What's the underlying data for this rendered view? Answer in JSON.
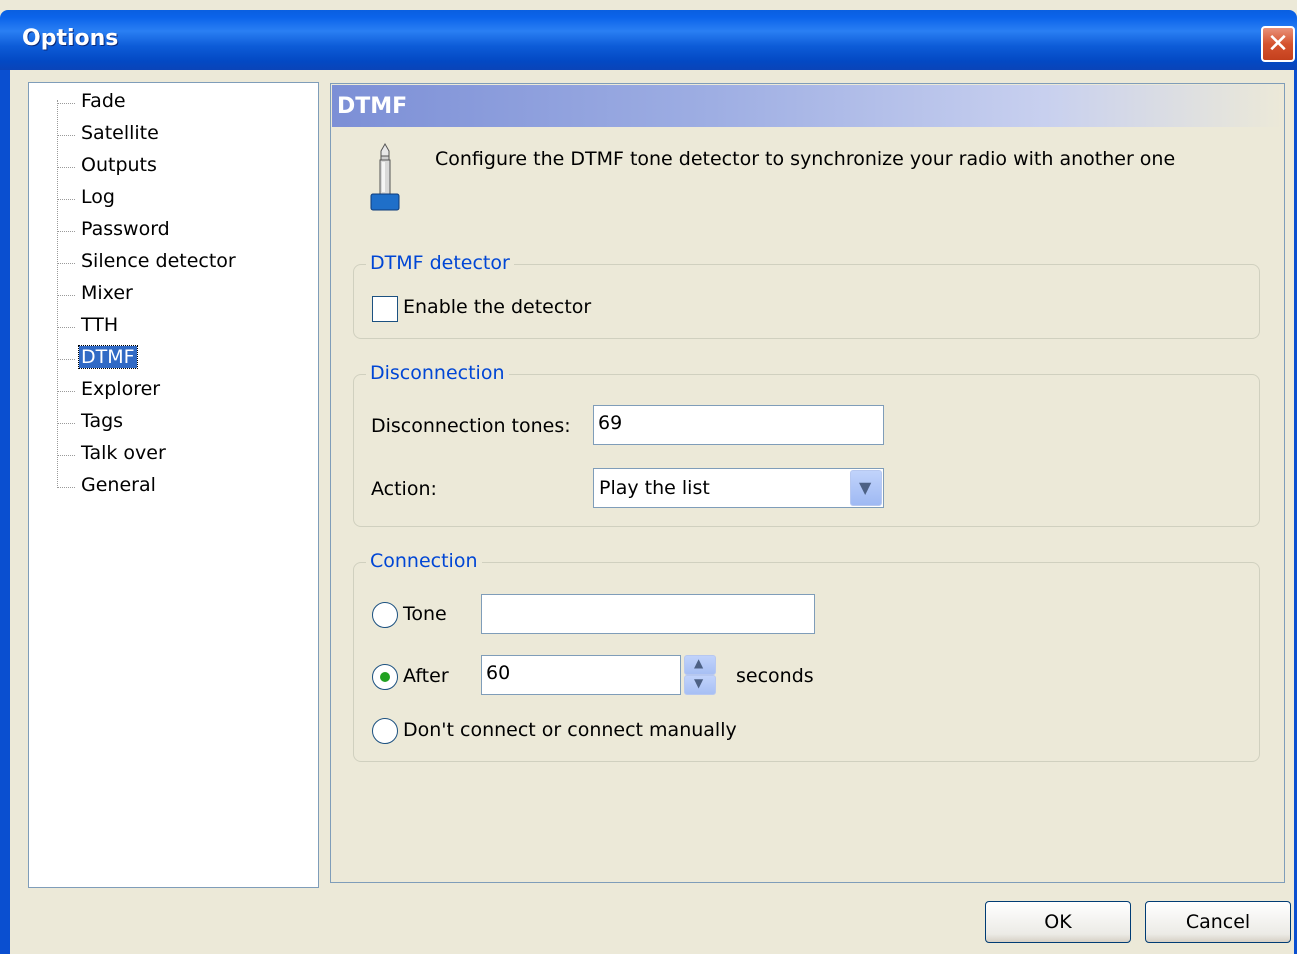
{
  "window": {
    "title": "Options",
    "close_glyph": "✕"
  },
  "tree": {
    "items": [
      {
        "label": "Fade"
      },
      {
        "label": "Satellite"
      },
      {
        "label": "Outputs"
      },
      {
        "label": "Log"
      },
      {
        "label": "Password"
      },
      {
        "label": "Silence detector"
      },
      {
        "label": "Mixer"
      },
      {
        "label": "TTH"
      },
      {
        "label": "DTMF",
        "selected": true
      },
      {
        "label": "Explorer"
      },
      {
        "label": "Tags"
      },
      {
        "label": "Talk over"
      },
      {
        "label": "General"
      }
    ]
  },
  "panel": {
    "header": "DTMF",
    "icon": "microphone-jack-icon",
    "intro": "Configure the DTMF tone detector to synchronize your radio with another one",
    "detector_group": {
      "legend": "DTMF detector",
      "enable_label": "Enable the detector",
      "enable_checked": false
    },
    "disconnection_group": {
      "legend": "Disconnection",
      "tones_label": "Disconnection tones:",
      "tones_value": "69",
      "action_label": "Action:",
      "action_value": "Play the list"
    },
    "connection_group": {
      "legend": "Connection",
      "tone_label": "Tone",
      "tone_value": "",
      "after_label": "After",
      "after_value": "60",
      "seconds_label": "seconds",
      "manual_label": "Don't connect or connect manually",
      "selected_option": "After"
    }
  },
  "footer": {
    "ok_label": "OK",
    "cancel_label": "Cancel"
  },
  "colors": {
    "accent": "#0046d5",
    "selection": "#316ac5",
    "titlebar": "#0b63ea"
  }
}
